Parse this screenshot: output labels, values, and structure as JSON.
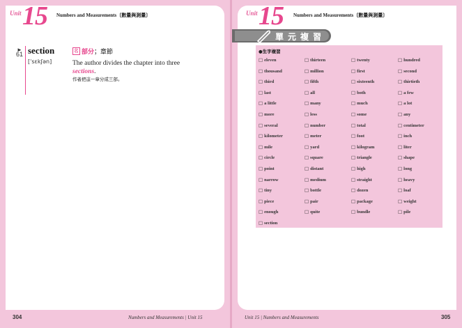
{
  "left_page": {
    "unit_word": "Unit",
    "unit_number": "15",
    "header_title": "Numbers and Measurements〔數量與測量〕",
    "entry": {
      "arrow": "►",
      "number": "61",
      "headword": "section",
      "phonetic": "[ˈsɛkʃən]",
      "pos": "名",
      "meaning": "部分",
      "meaning_rest": "；章節",
      "example_before": "The author divides the chapter into three",
      "example_highlight": "sections",
      "example_after": ".",
      "example_zh": "作者把這一章分成三部。"
    },
    "footer_page": "304",
    "footer_text": "Numbers and Measurements | Unit 15"
  },
  "right_page": {
    "unit_word": "Unit",
    "unit_number": "15",
    "header_title": "Numbers and Measurements〔數量與測量〕",
    "review_title": "單元複習",
    "wordbox_title": "●生字複習",
    "checkbox": "□",
    "words": [
      "eleven",
      "thirteen",
      "twenty",
      "hundred",
      "thousand",
      "million",
      "first",
      "second",
      "third",
      "fifth",
      "sixteenth",
      "thirtieth",
      "last",
      "all",
      "both",
      "a few",
      "a little",
      "many",
      "much",
      "a lot",
      "more",
      "less",
      "some",
      "any",
      "several",
      "number",
      "total",
      "centimeter",
      "kilometer",
      "meter",
      "foot",
      "inch",
      "mile",
      "yard",
      "kilogram",
      "liter",
      "circle",
      "square",
      "triangle",
      "shape",
      "point",
      "distant",
      "high",
      "long",
      "narrow",
      "medium",
      "straight",
      "heavy",
      "tiny",
      "bottle",
      "dozen",
      "loaf",
      "piece",
      "pair",
      "package",
      "weight",
      "enough",
      "quite",
      "bundle",
      "pile",
      "section"
    ],
    "footer_page": "305",
    "footer_text": "Unit 15 | Numbers and Measurements"
  },
  "colors": {
    "accent": "#e7488e",
    "page_bg": "#f3c6dc",
    "panel": "#ffffff",
    "banner": "#8e8e8e"
  }
}
